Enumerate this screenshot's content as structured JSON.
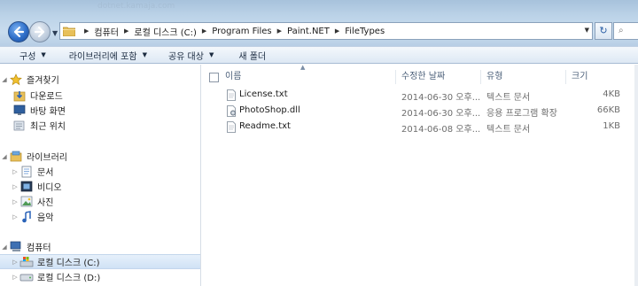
{
  "window": {
    "blurred_title": "dotnet.kamaja.com"
  },
  "address": {
    "crumbs": [
      "컴퓨터",
      "로컬 디스크 (C:)",
      "Program Files",
      "Paint.NET",
      "FileTypes"
    ]
  },
  "toolbar": {
    "organize": "구성",
    "include_library": "라이브러리에 포함",
    "share": "공유 대상",
    "new_folder": "새 폴더"
  },
  "sidebar": {
    "favorites": "즐겨찾기",
    "downloads": "다운로드",
    "desktop": "바탕 화면",
    "recent": "최근 위치",
    "libraries": "라이브러리",
    "documents": "문서",
    "videos": "비디오",
    "pictures": "사진",
    "music": "음악",
    "computer": "컴퓨터",
    "drive_c": "로컬 디스크 (C:)",
    "drive_d": "로컬 디스크 (D:)"
  },
  "columns": {
    "name": "이름",
    "date": "수정한 날짜",
    "type": "유형",
    "size": "크기"
  },
  "files": [
    {
      "name": "License.txt",
      "date": "2014-06-30 오후...",
      "type": "텍스트 문서",
      "size": "4KB"
    },
    {
      "name": "PhotoShop.dll",
      "date": "2014-06-30 오후...",
      "type": "응용 프로그램 확장",
      "size": "66KB"
    },
    {
      "name": "Readme.txt",
      "date": "2014-06-08 오후...",
      "type": "텍스트 문서",
      "size": "1KB"
    }
  ],
  "icons": {
    "back": "back-arrow-icon",
    "forward": "forward-arrow-icon",
    "folder": "folder-icon",
    "refresh": "refresh-icon",
    "search": "search-icon"
  },
  "colors": {
    "accent": "#2f6fc9",
    "selection": "#d0e2f5"
  }
}
